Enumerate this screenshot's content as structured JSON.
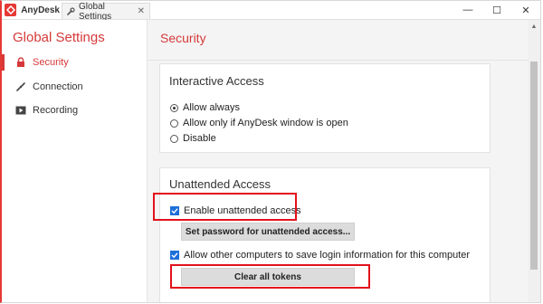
{
  "titlebar": {
    "app_name": "AnyDesk",
    "tab_label": "Global Settings",
    "tab_close": "✕",
    "minimize": "—",
    "maximize": "☐",
    "close": "✕"
  },
  "sidebar": {
    "title": "Global Settings",
    "items": [
      {
        "label": "Security",
        "icon": "lock-icon",
        "active": true
      },
      {
        "label": "Connection",
        "icon": "connection-icon",
        "active": false
      },
      {
        "label": "Recording",
        "icon": "recording-icon",
        "active": false
      }
    ]
  },
  "main": {
    "title": "Security",
    "interactive_access": {
      "title": "Interactive Access",
      "options": [
        {
          "label": "Allow always",
          "selected": true
        },
        {
          "label": "Allow only if AnyDesk window is open",
          "selected": false
        },
        {
          "label": "Disable",
          "selected": false
        }
      ]
    },
    "unattended_access": {
      "title": "Unattended Access",
      "enable_label": "Enable unattended access",
      "enable_checked": true,
      "set_password_label": "Set password for unattended access...",
      "allow_save_label": "Allow other computers to save login information for this computer",
      "allow_save_checked": true,
      "clear_tokens_label": "Clear all tokens"
    }
  },
  "colors": {
    "accent": "#d6393a",
    "highlight": "#e3111b",
    "checkbox": "#1e6fd9"
  }
}
